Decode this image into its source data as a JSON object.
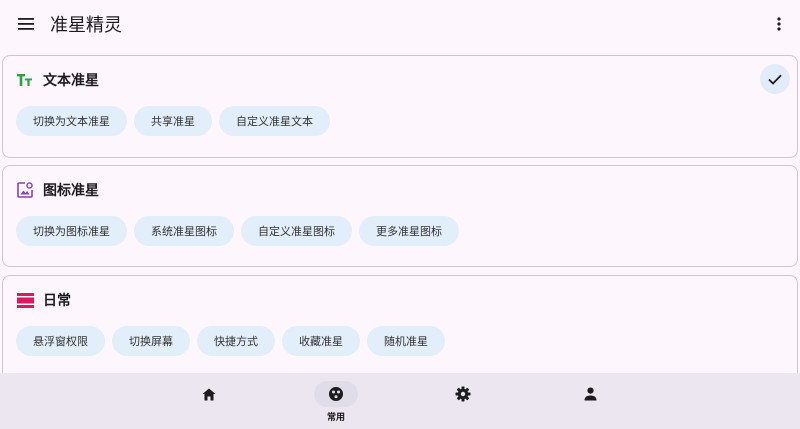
{
  "app": {
    "title": "准星精灵",
    "menu_icon": "menu-icon",
    "more_icon": "more-vert-icon"
  },
  "cards": [
    {
      "title": "文本准星",
      "icon": "text-format-icon",
      "icon_color": "#2e9f3a",
      "selected": true,
      "chips": [
        "切换为文本准星",
        "共享准星",
        "自定义准星文本"
      ]
    },
    {
      "title": "图标准星",
      "icon": "image-icon",
      "icon_color": "#8a3fc3",
      "selected": false,
      "chips": [
        "切换为图标准星",
        "系统准星图标",
        "自定义准星图标",
        "更多准星图标"
      ]
    },
    {
      "title": "日常",
      "icon": "menu-lines-icon",
      "icon_color": "#d81b60",
      "selected": false,
      "chips": [
        "悬浮窗权限",
        "切换屏幕",
        "快捷方式",
        "收藏准星",
        "随机准星"
      ]
    }
  ],
  "bottom_nav": {
    "items": [
      {
        "icon": "home-icon",
        "label": "",
        "active": false
      },
      {
        "icon": "crosshair-icon",
        "label": "常用",
        "active": true
      },
      {
        "icon": "settings-icon",
        "label": "",
        "active": false
      },
      {
        "icon": "person-icon",
        "label": "",
        "active": false
      }
    ]
  },
  "colors": {
    "background": "#fdf7fd",
    "chip_background": "#e2eef9",
    "nav_background": "#ece6f0",
    "card_border": "#cfc6d0"
  }
}
